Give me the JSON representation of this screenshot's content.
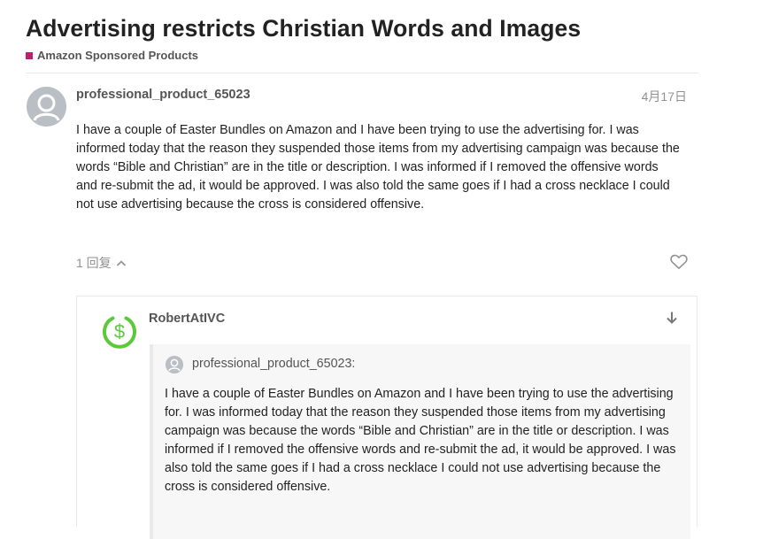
{
  "topic": {
    "title": "Advertising restricts Christian Words and Images",
    "category": {
      "name": "Amazon Sponsored Products",
      "color": "#BF1E6C"
    }
  },
  "post": {
    "author": "professional_product_65023",
    "date": "4月17日",
    "avatar_icon": "default-user-icon",
    "body": "I have a couple of Easter Bundles on Amazon and I have been trying to use the advertising for. I was informed today that the reason they suspended those items from my advertising campaign was because the words “Bible and Christian” are in the title or description. I was informed if I removed the offensive words and re-submit the ad, it would be approved. I was also told the same goes if I had a cross necklace I could not use advertising because the cross is considered offensive.",
    "replies_label": "1 回复",
    "replies_icon": "chevron-up-icon",
    "like_icon": "heart-icon"
  },
  "reply": {
    "author": "RobertAtIVC",
    "avatar_icon": "dollar-circle-icon",
    "avatar_color": "#5CC93B",
    "expand_icon": "arrow-down-icon",
    "quote": {
      "author": "professional_product_65023:",
      "body": "I have a couple of Easter Bundles on Amazon and I have been trying to use the advertising for. I was informed today that the reason they suspended those items from my advertising campaign was because the words “Bible and Christian” are in the title or description. I was informed if I removed the offensive words and re-submit the ad, it would be approved. I was also told the same goes if I had a cross necklace I could not use advertising because the cross is considered offensive."
    }
  }
}
